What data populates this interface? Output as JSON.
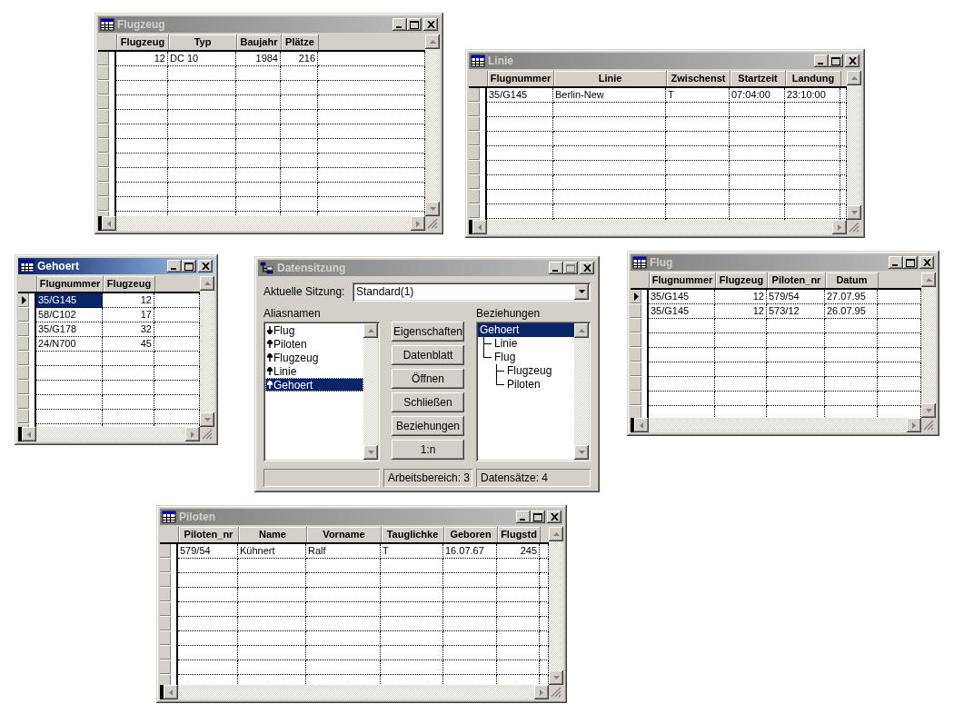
{
  "windows": [
    {
      "kind": "table",
      "title": "Flugzeug",
      "active": false,
      "maximize_disabled": false,
      "columns": [
        {
          "label": "Flugzeug",
          "kind": "number"
        },
        {
          "label": "Typ",
          "kind": "text"
        },
        {
          "label": "Baujahr",
          "kind": "number"
        },
        {
          "label": "Plätze",
          "kind": "number"
        }
      ],
      "rows": [
        {
          "current": false,
          "selected": false,
          "cells": [
            "12",
            "DC 10",
            "1984",
            "216"
          ]
        }
      ]
    },
    {
      "kind": "table",
      "title": "Linie",
      "active": false,
      "maximize_disabled": false,
      "columns": [
        {
          "label": "Flugnummer",
          "kind": "text"
        },
        {
          "label": "Linie",
          "kind": "text"
        },
        {
          "label": "Zwischenst",
          "kind": "text"
        },
        {
          "label": "Startzeit",
          "kind": "text"
        },
        {
          "label": "Landung",
          "kind": "text"
        }
      ],
      "rows": [
        {
          "current": false,
          "selected": false,
          "cells": [
            "35/G145",
            "Berlin-New",
            "T",
            "07:04:00",
            "23:10:00"
          ]
        }
      ]
    },
    {
      "kind": "table",
      "title": "Gehoert",
      "active": true,
      "maximize_disabled": false,
      "columns": [
        {
          "label": "Flugnummer",
          "kind": "text"
        },
        {
          "label": "Flugzeug",
          "kind": "number"
        }
      ],
      "rows": [
        {
          "current": true,
          "selected": true,
          "cells": [
            "35/G145",
            "12"
          ]
        },
        {
          "current": false,
          "selected": false,
          "cells": [
            "58/C102",
            "17"
          ]
        },
        {
          "current": false,
          "selected": false,
          "cells": [
            "35/G178",
            "32"
          ]
        },
        {
          "current": false,
          "selected": false,
          "cells": [
            "24/N700",
            "45"
          ]
        }
      ]
    },
    {
      "kind": "dialog",
      "title": "Datensitzung",
      "active": false,
      "maximize_disabled": true,
      "session_label": "Aktuelle Sitzung:",
      "session_value": "Standard(1)",
      "aliases_label": "Aliasnamen",
      "relations_label": "Beziehungen",
      "aliases": [
        {
          "label": "Flug",
          "kind": "down",
          "selected": false
        },
        {
          "label": "Piloten",
          "kind": "up",
          "selected": false
        },
        {
          "label": "Flugzeug",
          "kind": "up",
          "selected": false
        },
        {
          "label": "Linie",
          "kind": "up",
          "selected": false
        },
        {
          "label": "Gehoert",
          "kind": "up",
          "selected": true
        }
      ],
      "buttons": [
        "Eigenschaften",
        "Datenblatt",
        "Öffnen",
        "Schließen",
        "Beziehungen",
        "1:n"
      ],
      "relations": [
        {
          "label": "Gehoert",
          "selected": true,
          "children": [
            {
              "label": "Linie",
              "selected": false
            },
            {
              "label": "Flug",
              "selected": false,
              "children": [
                {
                  "label": "Flugzeug",
                  "selected": false
                },
                {
                  "label": "Piloten",
                  "selected": false
                }
              ]
            }
          ]
        }
      ],
      "status_bar": {
        "workspace": "Arbeitsbereich: 3",
        "records": "Datensätze: 4"
      }
    },
    {
      "kind": "table",
      "title": "Flug",
      "active": false,
      "maximize_disabled": false,
      "columns": [
        {
          "label": "Flugnummer",
          "kind": "text"
        },
        {
          "label": "Flugzeug",
          "kind": "number"
        },
        {
          "label": "Piloten_nr",
          "kind": "text"
        },
        {
          "label": "Datum",
          "kind": "text"
        }
      ],
      "rows": [
        {
          "current": true,
          "selected": false,
          "cells": [
            "35/G145",
            "12",
            "579/54",
            "27.07.95"
          ]
        },
        {
          "current": false,
          "selected": false,
          "cells": [
            "35/G145",
            "12",
            "573/12",
            "26.07.95"
          ]
        }
      ]
    },
    {
      "kind": "table",
      "title": "Piloten",
      "active": false,
      "maximize_disabled": false,
      "columns": [
        {
          "label": "Piloten_nr",
          "kind": "text"
        },
        {
          "label": "Name",
          "kind": "text"
        },
        {
          "label": "Vorname",
          "kind": "text"
        },
        {
          "label": "Tauglichke",
          "kind": "text"
        },
        {
          "label": "Geboren",
          "kind": "text"
        },
        {
          "label": "Flugstd",
          "kind": "number"
        }
      ],
      "rows": [
        {
          "current": false,
          "selected": false,
          "cells": [
            "579/54",
            "Kühnert",
            "Ralf",
            "T",
            "16.07.67",
            "245"
          ]
        }
      ]
    }
  ]
}
